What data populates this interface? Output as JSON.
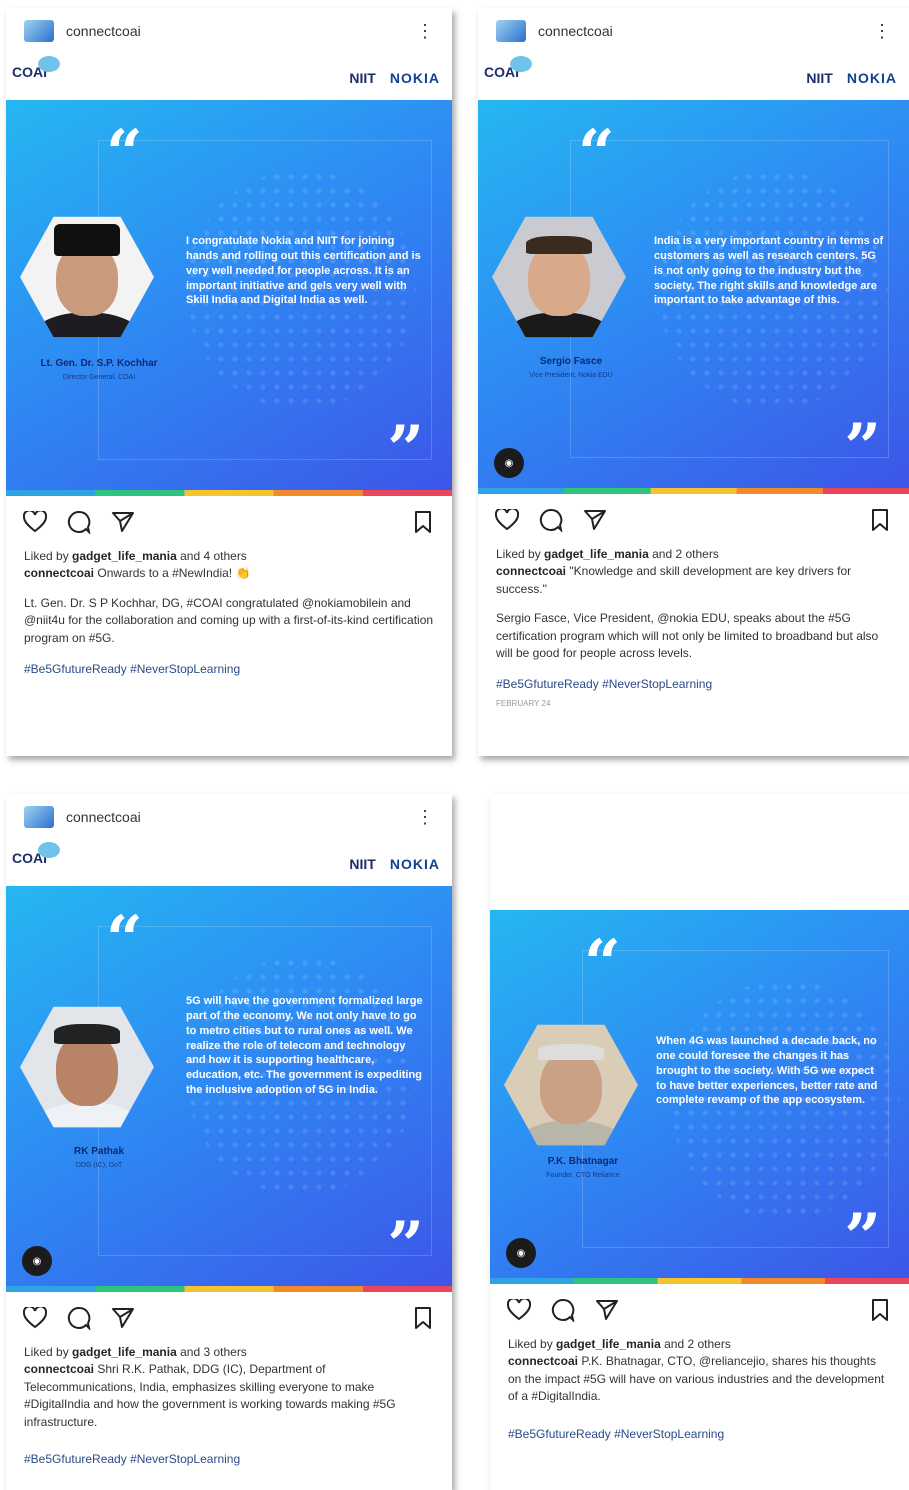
{
  "posts": [
    {
      "username": "connectcoai",
      "brand": {
        "coai": "COAI",
        "niit": "NIIT",
        "nokia": "NOKIA"
      },
      "speaker_name": "Lt. Gen. Dr. S.P. Kochhar",
      "speaker_role": "Director General, COAI",
      "quote": "I congratulate Nokia and NIIT for joining hands and rolling out this certification and is very well needed for people across. It is an important initiative and gels very well with Skill India and Digital India as well.",
      "likes_prefix": "Liked by",
      "likes_user": "gadget_life_mania",
      "likes_suffix": "and 4 others",
      "caption_user": "connectcoai",
      "caption_text": "Onwards to a #NewIndia!",
      "body": "Lt. Gen. Dr. S P Kochhar, DG, #COAI congratulated @nokiamobilein and @niit4u for the collaboration and coming up with a first-of-its-kind certification program on #5G.",
      "tags": "#Be5GfutureReady #NeverStopLearning"
    },
    {
      "username": "connectcoai",
      "brand": {
        "coai": "COAI",
        "niit": "NIIT",
        "nokia": "NOKIA"
      },
      "speaker_name": "Sergio Fasce",
      "speaker_role": "Vice President, Nokia EDU",
      "quote": "India is a very important country in terms of customers as well as research centers. 5G is not only going to the industry but the society. The right skills and knowledge are important to take advantage of this.",
      "likes_prefix": "Liked by",
      "likes_user": "gadget_life_mania",
      "likes_suffix": "and 2 others",
      "caption_user": "connectcoai",
      "caption_text": "\"Knowledge and skill development are key drivers for success.\"",
      "body": "Sergio Fasce, Vice President, @nokia EDU, speaks about the #5G certification program which will not only be limited to broadband but also will be good for people across levels.",
      "tags": "#Be5GfutureReady #NeverStopLearning",
      "date": "February 24"
    },
    {
      "username": "connectcoai",
      "brand": {
        "coai": "COAI",
        "niit": "NIIT",
        "nokia": "NOKIA"
      },
      "speaker_name": "RK Pathak",
      "speaker_role": "DDG (IC), DoT",
      "quote": "5G will have the government formalized large part of the economy. We not only have to go to metro cities but to rural ones as well. We realize the role of telecom and technology and how it is supporting healthcare, education, etc. The government is expediting the inclusive adoption of 5G in India.",
      "likes_prefix": "Liked by",
      "likes_user": "gadget_life_mania",
      "likes_suffix": "and 3 others",
      "caption_user": "connectcoai",
      "caption_text": "Shri R.K. Pathak, DDG (IC), Department of Telecommunications, India, emphasizes skilling everyone to make #DigitalIndia and how the government is working towards making #5G infrastructure.",
      "tags": "#Be5GfutureReady #NeverStopLearning"
    },
    {
      "speaker_name": "P.K. Bhatnagar",
      "speaker_role": "Founder, CTO Reliance",
      "quote": "When 4G was launched a decade back, no one could foresee the changes it has brought to the society. With 5G we expect to have better experiences, better rate and complete revamp of the app ecosystem.",
      "likes_prefix": "Liked by",
      "likes_user": "gadget_life_mania",
      "likes_suffix": "and 2 others",
      "caption_user": "connectcoai",
      "caption_text": "P.K. Bhatnagar, CTO, @reliancejio, shares his thoughts on the impact #5G will have on various industries and the development of a #DigitalIndia.",
      "tags": "#Be5GfutureReady #NeverStopLearning"
    }
  ],
  "icons": [
    "heart-icon",
    "comment-icon",
    "share-icon",
    "bookmark-icon",
    "more-icon",
    "play-icon"
  ],
  "colors": {
    "banner_top": "#25b7f2",
    "banner_bottom": "#3d55e8",
    "tag_blue": "#2a4a8a"
  }
}
